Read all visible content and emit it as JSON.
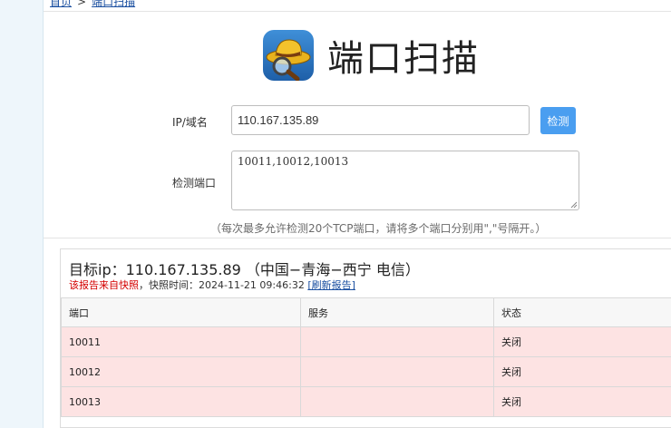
{
  "breadcrumb": {
    "home": "首页",
    "current": "端口扫描"
  },
  "header": {
    "title": "端口扫描"
  },
  "form": {
    "ip_label": "IP/域名",
    "ip_value": "110.167.135.89",
    "check_button": "检测",
    "port_label": "检测端口",
    "port_value": "10011,10012,10013",
    "hint": "（每次最多允许检测20个TCP端口，请将多个端口分别用\",\"号隔开。）"
  },
  "result": {
    "title": "目标ip：110.167.135.89 （中国−青海−西宁 电信）",
    "snapshot_prefix": "该报告来自快照",
    "snapshot_time": "，快照时间：2024-11-21 09:46:32",
    "refresh_link": "[刷新报告]",
    "columns": [
      "端口",
      "服务",
      "状态"
    ],
    "rows": [
      {
        "port": "10011",
        "service": "",
        "status": "关闭"
      },
      {
        "port": "10012",
        "service": "",
        "status": "关闭"
      },
      {
        "port": "10013",
        "service": "",
        "status": "关闭"
      }
    ]
  },
  "colors": {
    "accent": "#4a9ef0",
    "closed_row": "#fde3e3",
    "warning_text": "#d40000",
    "link": "#1a4fa0"
  },
  "icons": {
    "app": "hat-magnifier-icon"
  }
}
